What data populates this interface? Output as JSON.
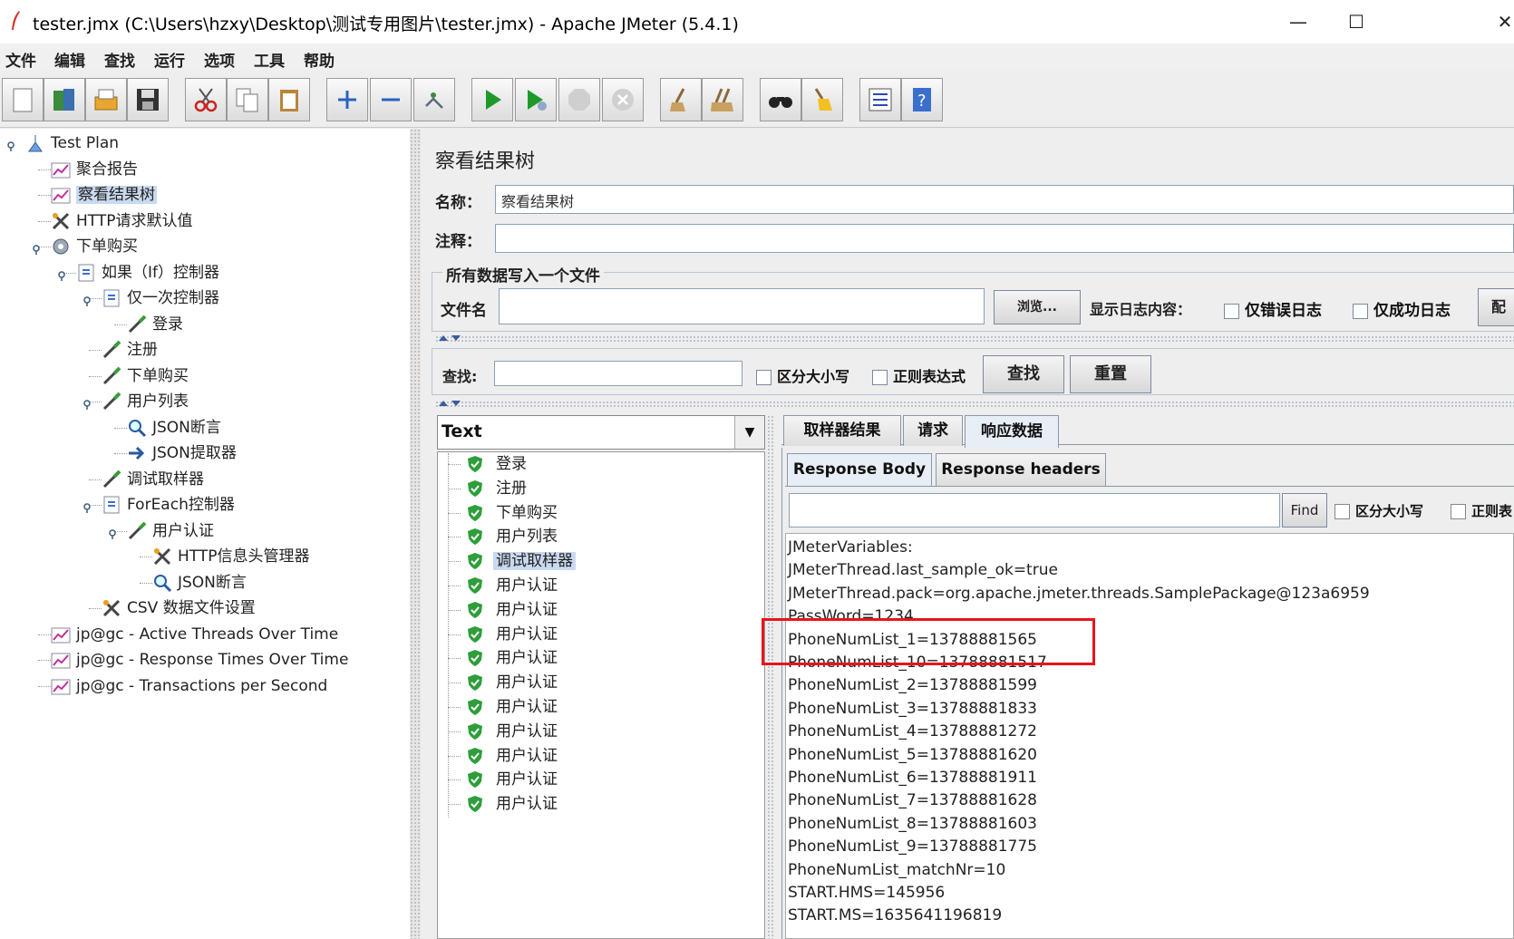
{
  "window": {
    "title": "tester.jmx (C:\\Users\\hzxy\\Desktop\\测试专用图片\\tester.jmx) - Apache JMeter (5.4.1)",
    "minimize_icon": "—",
    "maximize_icon": "☐",
    "close_icon": "✕"
  },
  "menu": [
    "文件",
    "编辑",
    "查找",
    "运行",
    "选项",
    "工具",
    "帮助"
  ],
  "toolbar": {
    "icons": [
      "new-icon",
      "templates-icon",
      "open-icon",
      "save-icon",
      "cut-icon",
      "copy-icon",
      "paste-icon",
      "expand-icon",
      "collapse-icon",
      "toggle-icon",
      "start-icon",
      "start-no-pause-icon",
      "stop-icon",
      "shutdown-icon",
      "clear-icon",
      "clear-all-icon",
      "search-icon",
      "reset-search-icon",
      "function-helper-icon",
      "help-icon"
    ]
  },
  "tree": [
    {
      "label": "Test Plan",
      "icon": "test-plan-icon"
    },
    {
      "label": "聚合报告",
      "icon": "graph-icon"
    },
    {
      "label": "察看结果树",
      "icon": "graph-icon",
      "selected": true
    },
    {
      "label": "HTTP请求默认值",
      "icon": "wrench-icon"
    },
    {
      "label": "下单购买",
      "icon": "gear-icon"
    },
    {
      "label": "如果（If）控制器",
      "icon": "controller-icon"
    },
    {
      "label": "仅一次控制器",
      "icon": "controller-icon"
    },
    {
      "label": "登录",
      "icon": "pipette-icon"
    },
    {
      "label": "注册",
      "icon": "pipette-icon"
    },
    {
      "label": "下单购买",
      "icon": "pipette-icon"
    },
    {
      "label": "用户列表",
      "icon": "pipette-icon"
    },
    {
      "label": "JSON断言",
      "icon": "magnifier-icon"
    },
    {
      "label": "JSON提取器",
      "icon": "extractor-icon"
    },
    {
      "label": "调试取样器",
      "icon": "pipette-icon"
    },
    {
      "label": "ForEach控制器",
      "icon": "controller-icon"
    },
    {
      "label": "用户认证",
      "icon": "pipette-icon"
    },
    {
      "label": "HTTP信息头管理器",
      "icon": "wrench-icon"
    },
    {
      "label": "JSON断言",
      "icon": "magnifier-icon"
    },
    {
      "label": "CSV 数据文件设置",
      "icon": "wrench-icon"
    },
    {
      "label": "jp@gc - Active Threads Over Time",
      "icon": "graph-icon"
    },
    {
      "label": "jp@gc - Response Times Over Time",
      "icon": "graph-icon"
    },
    {
      "label": "jp@gc - Transactions per Second",
      "icon": "graph-icon"
    }
  ],
  "panel": {
    "title": "察看结果树",
    "name_label": "名称：",
    "name_value": "察看结果树",
    "comment_label": "注释：",
    "comment_value": "",
    "file_group_title": "所有数据写入一个文件",
    "filename_label": "文件名",
    "filename_value": "",
    "browse_button": "浏览...",
    "log_label": "显示日志内容：",
    "errors_only": "仅错误日志",
    "success_only": "仅成功日志",
    "config_button_partial": "配"
  },
  "search": {
    "label": "查找:",
    "value": "",
    "case_sensitive": "区分大小写",
    "regex": "正则表达式",
    "find_button": "查找",
    "reset_button": "重置"
  },
  "renderer": {
    "selected": "Text",
    "dropdown_icon": "▼"
  },
  "results": [
    {
      "label": "登录"
    },
    {
      "label": "注册"
    },
    {
      "label": "下单购买"
    },
    {
      "label": "用户列表"
    },
    {
      "label": "调试取样器",
      "selected": true
    },
    {
      "label": "用户认证"
    },
    {
      "label": "用户认证"
    },
    {
      "label": "用户认证"
    },
    {
      "label": "用户认证"
    },
    {
      "label": "用户认证"
    },
    {
      "label": "用户认证"
    },
    {
      "label": "用户认证"
    },
    {
      "label": "用户认证"
    },
    {
      "label": "用户认证"
    },
    {
      "label": "用户认证"
    }
  ],
  "tabs": [
    "取样器结果",
    "请求",
    "响应数据"
  ],
  "subtabs": [
    "Response Body",
    "Response headers"
  ],
  "body_search": {
    "value": "",
    "find_button": "Find",
    "case_sensitive": "区分大小写",
    "regex_partial": "正则表"
  },
  "response_body": [
    "JMeterVariables:",
    "JMeterThread.last_sample_ok=true",
    "JMeterThread.pack=org.apache.jmeter.threads.SamplePackage@123a6959",
    "PassWord=1234",
    "PhoneNumList_1=13788881565",
    "PhoneNumList_10=13788881517",
    "PhoneNumList_2=13788881599",
    "PhoneNumList_3=13788881833",
    "PhoneNumList_4=13788881272",
    "PhoneNumList_5=13788881620",
    "PhoneNumList_6=13788881911",
    "PhoneNumList_7=13788881628",
    "PhoneNumList_8=13788881603",
    "PhoneNumList_9=13788881775",
    "PhoneNumList_matchNr=10",
    "START.HMS=145956",
    "START.MS=1635641196819"
  ],
  "colors": {
    "highlight_box": "#e8141c",
    "selection": "#c9d9ef",
    "success": "#2e9e3a"
  }
}
